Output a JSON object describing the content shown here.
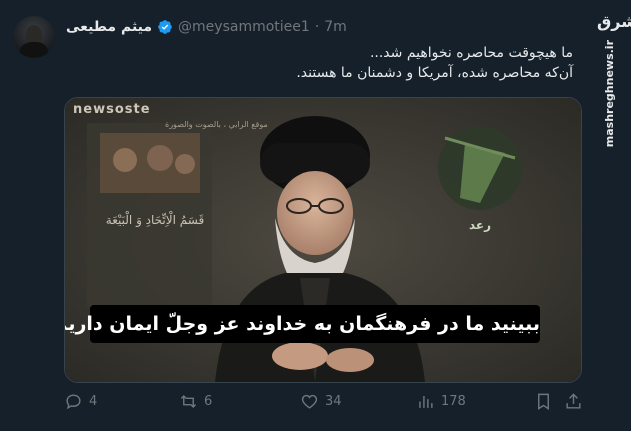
{
  "tweet": {
    "display_name": "میثم مطیعی",
    "handle": "@meysammotiee1",
    "separator": "·",
    "time": "7m",
    "text_line1": "ما هیچوقت محاصره نخواهیم شد...",
    "text_line2": "آن‌که محاصره شده، آمریکا و دشمنان ما هستند."
  },
  "media": {
    "brand": "newsoste",
    "brand_sub": "موقع الرابي ، بالصوت والصورة",
    "poster_title": "قَسَمُ الْاِتِّحَادِ وَ الْبَيْعَة",
    "subtitle": "ببینید ما در فرهنگمان به خداوند عز وجلّ ایمان داریم",
    "emblem_text": "رعد"
  },
  "actions": {
    "replies": "4",
    "reposts": "6",
    "likes": "34",
    "views": "178"
  },
  "watermark": {
    "logo": "مشرق",
    "url": "mashreghnews.ir"
  },
  "colors": {
    "background": "#15202b",
    "text": "#e7e9ea",
    "muted": "#71767b",
    "verified": "#1d9bf0",
    "border": "#38444d"
  }
}
